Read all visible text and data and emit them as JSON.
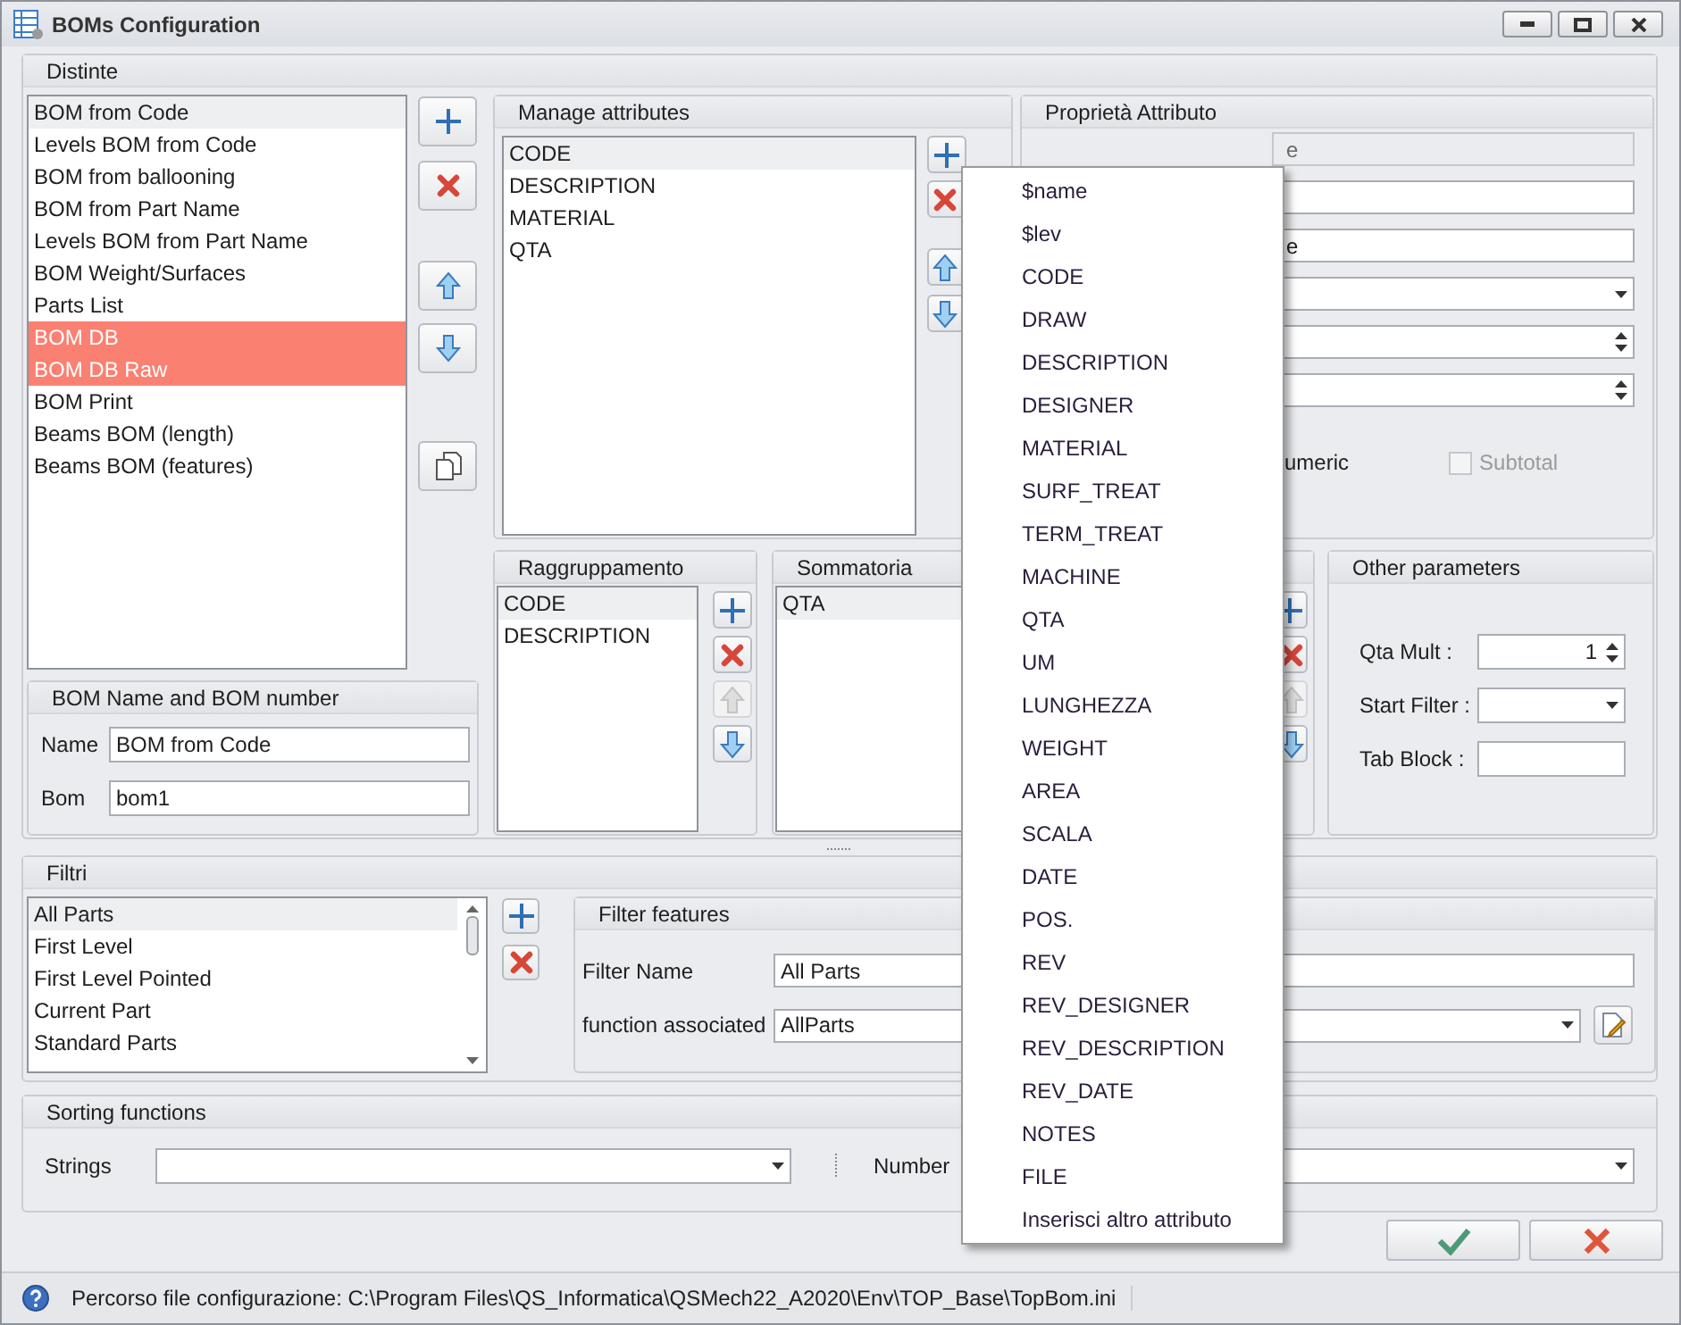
{
  "window": {
    "title": "BOMs Configuration"
  },
  "distinte": {
    "title": "Distinte",
    "boms": [
      {
        "label": "BOM from Code",
        "selected": false,
        "focused": true
      },
      {
        "label": "Levels BOM from Code",
        "selected": false,
        "focused": false
      },
      {
        "label": "BOM from ballooning",
        "selected": false,
        "focused": false
      },
      {
        "label": "BOM from Part Name",
        "selected": false,
        "focused": false
      },
      {
        "label": "Levels BOM from Part Name",
        "selected": false,
        "focused": false
      },
      {
        "label": "BOM Weight/Surfaces",
        "selected": false,
        "focused": false
      },
      {
        "label": "Parts List",
        "selected": false,
        "focused": false
      },
      {
        "label": "BOM DB",
        "selected": true,
        "focused": false
      },
      {
        "label": "BOM DB Raw",
        "selected": true,
        "focused": false
      },
      {
        "label": "BOM Print",
        "selected": false,
        "focused": false
      },
      {
        "label": "Beams BOM (length)",
        "selected": false,
        "focused": false
      },
      {
        "label": "Beams BOM (features)",
        "selected": false,
        "focused": false
      }
    ],
    "buttons": [
      {
        "kind": "add",
        "disabled": false
      },
      {
        "kind": "remove",
        "disabled": false
      },
      {
        "kind": "up",
        "disabled": false
      },
      {
        "kind": "down",
        "disabled": false
      },
      {
        "kind": "copy",
        "disabled": false
      }
    ]
  },
  "bom_name": {
    "title": "BOM Name and BOM number",
    "fields": [
      {
        "label": "Name",
        "value": "BOM from Code"
      },
      {
        "label": "Bom",
        "value": "bom1"
      }
    ]
  },
  "manage_attributes": {
    "title": "Manage attributes",
    "items": [
      {
        "label": "CODE",
        "selected": true
      },
      {
        "label": "DESCRIPTION",
        "selected": false
      },
      {
        "label": "MATERIAL",
        "selected": false
      },
      {
        "label": "QTA",
        "selected": false
      }
    ],
    "buttons": [
      {
        "kind": "add",
        "disabled": false
      },
      {
        "kind": "remove",
        "disabled": false
      },
      {
        "kind": "up",
        "disabled": false
      },
      {
        "kind": "down",
        "disabled": false
      }
    ]
  },
  "attribute_properties": {
    "title": "Proprietà Attributo",
    "fields": [
      {
        "kind": "text",
        "value": "e",
        "disabled": true
      },
      {
        "kind": "text",
        "disabled": false
      },
      {
        "kind": "text",
        "value": "e",
        "disabled": false
      },
      {
        "kind": "dropdown",
        "disabled": false
      },
      {
        "kind": "spinner",
        "disabled": false
      },
      {
        "kind": "spinner",
        "disabled": false
      }
    ],
    "checkboxes": [
      {
        "label": "umeric",
        "disabled": false
      },
      {
        "label": "Subtotal",
        "checked": false,
        "disabled": true
      }
    ]
  },
  "grouping": {
    "title": "Raggruppamento",
    "items": [
      {
        "label": "CODE",
        "selected": true
      },
      {
        "label": "DESCRIPTION",
        "selected": false
      }
    ],
    "buttons": [
      {
        "kind": "add",
        "disabled": false
      },
      {
        "kind": "remove",
        "disabled": false
      },
      {
        "kind": "up",
        "disabled": true
      },
      {
        "kind": "down",
        "disabled": false
      }
    ]
  },
  "summation": {
    "title": "Sommatoria",
    "items": [
      {
        "label": "QTA",
        "selected": true
      }
    ],
    "buttons": [
      {
        "kind": "add",
        "disabled": false
      },
      {
        "kind": "remove",
        "disabled": false
      },
      {
        "kind": "up",
        "disabled": true
      },
      {
        "kind": "down",
        "disabled": false
      }
    ]
  },
  "other_parameters": {
    "title": "Other parameters",
    "fields": [
      {
        "kind": "spinner",
        "label": "Qta Mult :",
        "value": "1"
      },
      {
        "kind": "dropdown",
        "label": "Start Filter :"
      },
      {
        "kind": "text",
        "label": "Tab Block :"
      }
    ]
  },
  "filters": {
    "title": "Filtri",
    "items": [
      {
        "label": "All Parts",
        "selected": true
      },
      {
        "label": "First Level",
        "selected": false
      },
      {
        "label": "First Level Pointed",
        "selected": false
      },
      {
        "label": "Current Part",
        "selected": false
      },
      {
        "label": "Standard Parts",
        "selected": false
      }
    ],
    "buttons": [
      {
        "kind": "add",
        "disabled": false
      },
      {
        "kind": "remove",
        "disabled": false
      }
    ]
  },
  "filter_features": {
    "title": "Filter features",
    "fields": [
      {
        "kind": "text",
        "label": "Filter Name",
        "value": "All Parts"
      },
      {
        "kind": "dropdown",
        "label": "function associated",
        "value": "AllParts"
      }
    ]
  },
  "sorting": {
    "title": "Sorting functions",
    "fields": [
      {
        "kind": "dropdown",
        "label": "Strings"
      },
      {
        "kind": "dropdown",
        "label": "Number"
      }
    ]
  },
  "menu": {
    "items": [
      "$name",
      "$lev",
      "CODE",
      "DRAW",
      "DESCRIPTION",
      "DESIGNER",
      "MATERIAL",
      "SURF_TREAT",
      "TERM_TREAT",
      "MACHINE",
      "QTA",
      "UM",
      "LUNGHEZZA",
      "WEIGHT",
      "AREA",
      "SCALA",
      "DATE",
      "POS.",
      "REV",
      "REV_DESIGNER",
      "REV_DESCRIPTION",
      "REV_DATE",
      "NOTES",
      "FILE",
      "Inserisci altro attributo"
    ]
  },
  "status_bar": {
    "text": "Percorso file configurazione: C:\\Program Files\\QS_Informatica\\QSMech22_A2020\\Env\\TOP_Base\\TopBom.ini"
  }
}
